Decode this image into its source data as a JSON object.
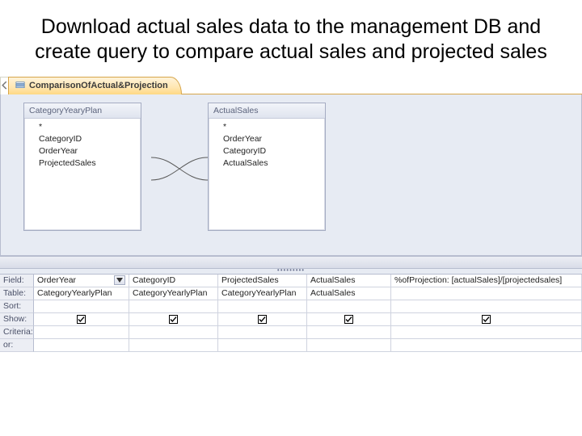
{
  "title": "Download actual sales data to the management DB and create query to compare actual sales and projected sales",
  "tab": {
    "label": "ComparisonOfActual&Projection"
  },
  "tables": {
    "left": {
      "title": "CategoryYearyPlan",
      "fields": [
        "*",
        "CategoryID",
        "OrderYear",
        "ProjectedSales"
      ]
    },
    "right": {
      "title": "ActualSales",
      "fields": [
        "*",
        "OrderYear",
        "CategoryID",
        "ActualSales"
      ]
    }
  },
  "gridLabels": {
    "field": "Field:",
    "table": "Table:",
    "sort": "Sort:",
    "show": "Show:",
    "criteria": "Criteria:",
    "or": "or:"
  },
  "columns": [
    {
      "field": "OrderYear",
      "table": "CategoryYearlyPlan",
      "show": true,
      "selected": true
    },
    {
      "field": "CategoryID",
      "table": "CategoryYearlyPlan",
      "show": true
    },
    {
      "field": "ProjectedSales",
      "table": "CategoryYearlyPlan",
      "show": true
    },
    {
      "field": "ActualSales",
      "table": "ActualSales",
      "show": true
    },
    {
      "field": "%ofProjection: [actualSales]/[projectedsales]",
      "table": "",
      "show": true
    }
  ]
}
